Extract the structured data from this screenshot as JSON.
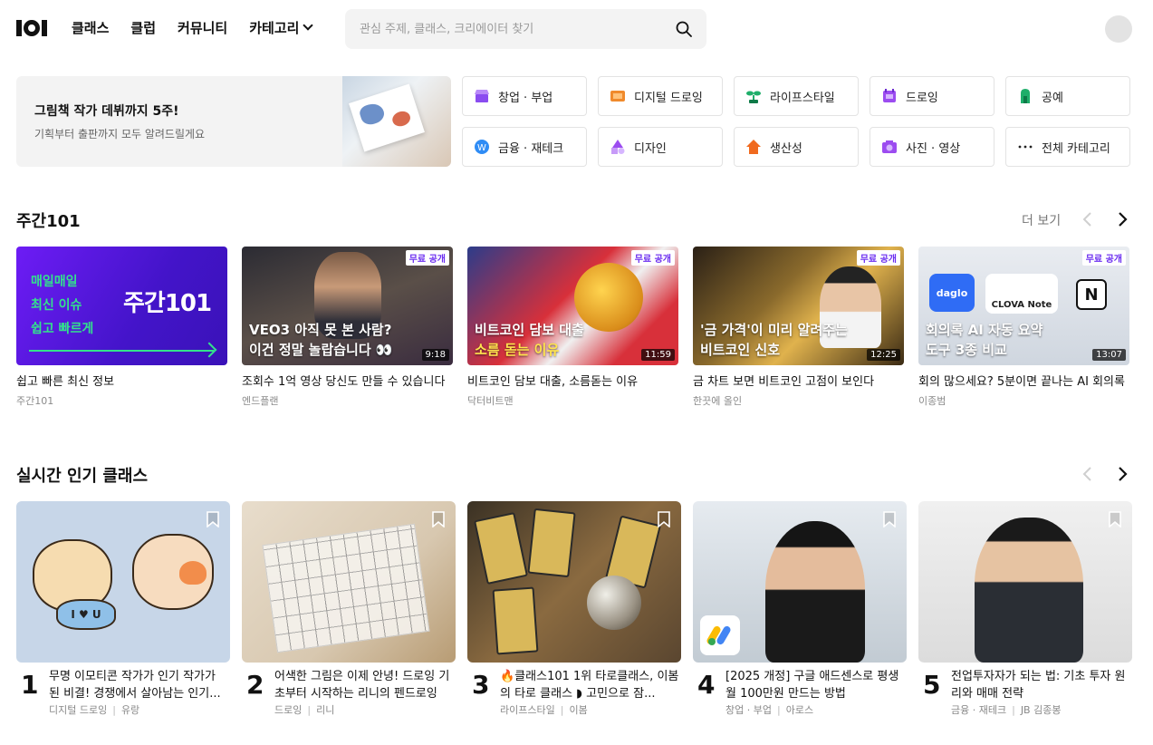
{
  "header": {
    "nav": [
      "클래스",
      "클럽",
      "커뮤니티",
      "카테고리"
    ],
    "search_placeholder": "관심 주제, 클래스, 크리에이터 찾기"
  },
  "banner": {
    "title": "그림책 작가 데뷔까지 5주!",
    "subtitle": "기획부터 출판까지 모두 알려드릴게요"
  },
  "categories": [
    {
      "label": "창업 · 부업",
      "icon": "shop-icon",
      "color": "#8a4cf0"
    },
    {
      "label": "디지털 드로잉",
      "icon": "tablet-drawing-icon",
      "color": "#f08a2c"
    },
    {
      "label": "라이프스타일",
      "icon": "sprout-icon",
      "color": "#1fae6a"
    },
    {
      "label": "드로잉",
      "icon": "sketchbook-icon",
      "color": "#9c4cf0"
    },
    {
      "label": "공예",
      "icon": "craft-icon",
      "color": "#1fae6a"
    },
    {
      "label": "금융 · 재테크",
      "icon": "coin-icon",
      "color": "#2f8cf5"
    },
    {
      "label": "디자인",
      "icon": "shapes-icon",
      "color": "#9c4cf0"
    },
    {
      "label": "생산성",
      "icon": "house-up-icon",
      "color": "#f06a1f"
    },
    {
      "label": "사진 · 영상",
      "icon": "camera-icon",
      "color": "#9c4cf0"
    },
    {
      "label": "전체 카테고리",
      "icon": "more-dots-icon",
      "color": "#222222"
    }
  ],
  "weekly": {
    "title": "주간101",
    "more": "더 보기",
    "intro_lines": [
      "매일매일",
      "최신 이슈",
      "쉽고 빠르게"
    ],
    "intro_logo": "주간101",
    "free_badge": "무료 공개",
    "items": [
      {
        "title": "쉽고 빠른 최신 정보",
        "author": "주간101"
      },
      {
        "title": "조회수 1억 영상 당신도 만들 수 있습니다",
        "author": "엔드플랜",
        "caption1": "VEO3 아직 못 본 사람?",
        "caption2": "이건 정말 놀랍습니다 👀",
        "duration": "9:18"
      },
      {
        "title": "비트코인 담보 대출, 소름돋는 이유",
        "author": "닥터비트맨",
        "caption1": "비트코인 담보 대출",
        "caption2": "소름 돋는 이유",
        "duration": "11:59"
      },
      {
        "title": "금 차트 보면 비트코인 고점이 보인다",
        "author": "한끗에 올인",
        "caption1": "'금 가격'이 미리 알려주는",
        "caption2": "비트코인 신호",
        "duration": "12:25"
      },
      {
        "title": "회의 많으세요? 5분이면 끝나는 AI 회의록",
        "author": "이종범",
        "caption1": "회의록 AI 자동 요약",
        "caption2": "도구 3종 비교",
        "duration": "13:07",
        "logos": [
          "daglo",
          "CLOVA Note",
          "N"
        ]
      }
    ]
  },
  "popular": {
    "title": "실시간 인기 클래스",
    "items": [
      {
        "rank": "1",
        "title": "무명 이모티콘 작가가 인기 작가가 된 비결! 경쟁에서 살아남는 인기...",
        "category": "디지털 드로잉",
        "author": "유랑",
        "shirt_text": "I ♥ U"
      },
      {
        "rank": "2",
        "title": "어색한 그림은 이제 안녕! 드로잉 기초부터 시작하는 리니의 펜드로잉",
        "category": "드로잉",
        "author": "리니"
      },
      {
        "rank": "3",
        "title": "🔥클래스101 1위 타로클래스, 이봄의 타로 클래스 ◗ 고민으로 잠...",
        "category": "라이프스타일",
        "author": "이봄"
      },
      {
        "rank": "4",
        "title": "[2025 개정] 구글 애드센스로 평생 월 100만원 만드는 방법",
        "category": "창업 · 부업",
        "author": "아로스"
      },
      {
        "rank": "5",
        "title": "전업투자자가 되는 법: 기초 투자 원리와 매매 전략",
        "category": "금융 · 재테크",
        "author": "JB 김종봉"
      }
    ]
  }
}
